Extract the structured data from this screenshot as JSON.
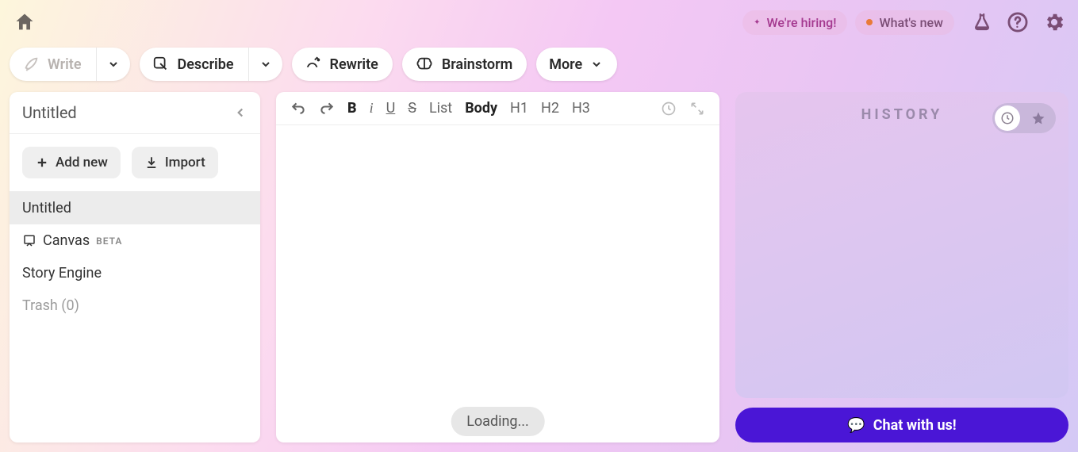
{
  "topbar": {
    "hiring_label": "We're hiring!",
    "whatsnew_label": "What's new"
  },
  "actions": {
    "write": "Write",
    "describe": "Describe",
    "rewrite": "Rewrite",
    "brainstorm": "Brainstorm",
    "more": "More"
  },
  "sidebar": {
    "title": "Untitled",
    "add_new": "Add new",
    "import": "Import",
    "items": [
      {
        "label": "Untitled",
        "active": true
      },
      {
        "label": "Canvas",
        "badge": "BETA"
      },
      {
        "label": "Story Engine"
      },
      {
        "label": "Trash (0)",
        "trash": true
      }
    ]
  },
  "editor": {
    "toolbar": {
      "list": "List",
      "body": "Body",
      "h1": "H1",
      "h2": "H2",
      "h3": "H3"
    },
    "loading": "Loading..."
  },
  "right": {
    "history_title": "HISTORY",
    "chat_label": "Chat with us!"
  }
}
